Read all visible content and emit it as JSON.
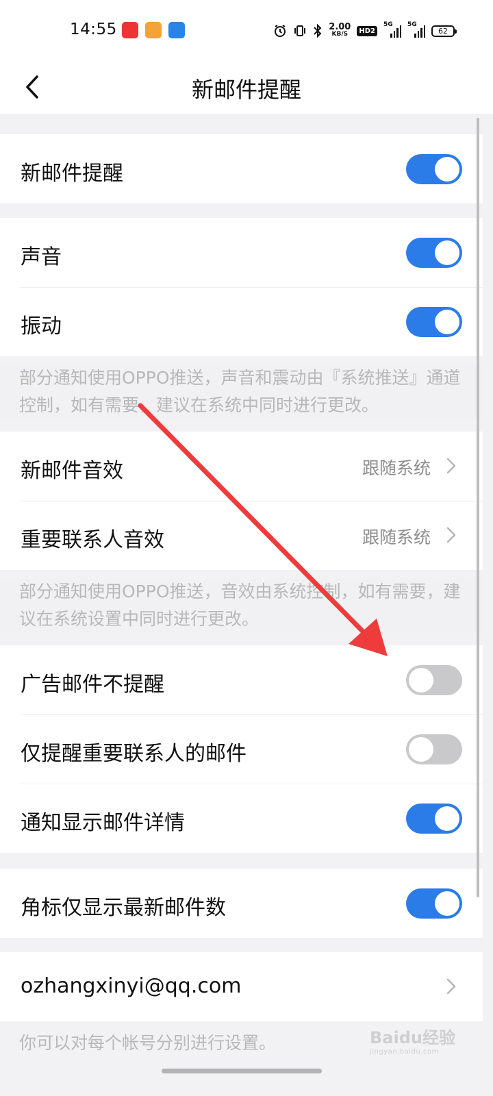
{
  "status_bar": {
    "time": "14:55",
    "net_speed_value": "2.00",
    "net_speed_unit": "KB/S",
    "hd_badge": "HD2",
    "signal1": "5G",
    "signal2": "5G",
    "battery": "62",
    "icons": [
      "oppo-app-icon",
      "weibo-icon",
      "alipay-icon",
      "alarm-icon",
      "vibrate-icon",
      "bluetooth-icon"
    ]
  },
  "header": {
    "title": "新邮件提醒"
  },
  "sections": {
    "main": {
      "new_mail_alert": {
        "label": "新邮件提醒",
        "on": true
      }
    },
    "sound_vibrate": {
      "sound": {
        "label": "声音",
        "on": true
      },
      "vibrate": {
        "label": "振动",
        "on": true
      }
    },
    "note1": "部分通知使用OPPO推送，声音和震动由『系统推送』通道控制，如有需要，建议在系统中同时进行更改。",
    "effects": {
      "new_mail_sound": {
        "label": "新邮件音效",
        "value": "跟随系统"
      },
      "vip_sound": {
        "label": "重要联系人音效",
        "value": "跟随系统"
      }
    },
    "note2": "部分通知使用OPPO推送，音效由系统控制，如有需要，建议在系统设置中同时进行更改。",
    "filters": {
      "no_ad_alert": {
        "label": "广告邮件不提醒",
        "on": false
      },
      "vip_only": {
        "label": "仅提醒重要联系人的邮件",
        "on": false
      },
      "show_details": {
        "label": "通知显示邮件详情",
        "on": true
      }
    },
    "badge": {
      "badge_latest": {
        "label": "角标仅显示最新邮件数",
        "on": true
      }
    },
    "account": {
      "email": "ozhangxinyi@qq.com"
    },
    "note3": "你可以对每个帐号分别进行设置。"
  },
  "watermark": {
    "text": "Baidu经验",
    "sub": "jingyan.baidu.com"
  },
  "colors": {
    "accent": "#2b7ce9",
    "toggle_off": "#c9c9cc",
    "annotation_arrow": "#ee3b3b"
  }
}
